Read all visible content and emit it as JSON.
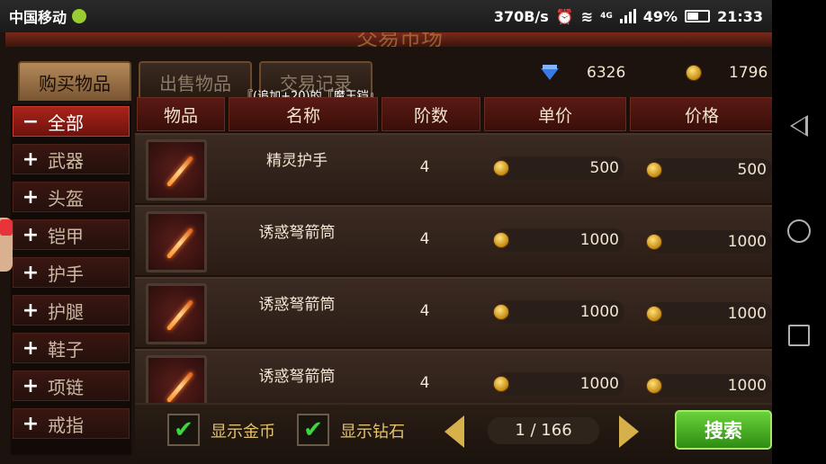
{
  "status_bar": {
    "carrier": "中国移动",
    "net_speed": "370B/s",
    "network_type": "4G",
    "battery": "49%",
    "time": "21:33"
  },
  "title_partial": "交易市场",
  "tabs": [
    {
      "label": "购买物品",
      "active": true
    },
    {
      "label": "出售物品",
      "active": false
    },
    {
      "label": "交易记录",
      "active": false
    }
  ],
  "currency": {
    "diamonds": "6326",
    "gold": "1796"
  },
  "tooltip": "『(追加+20)的『魔王铠』",
  "categories": [
    {
      "symbol": "−",
      "label": "全部",
      "active": true
    },
    {
      "symbol": "+",
      "label": "武器"
    },
    {
      "symbol": "+",
      "label": "头盔"
    },
    {
      "symbol": "+",
      "label": "铠甲"
    },
    {
      "symbol": "+",
      "label": "护手"
    },
    {
      "symbol": "+",
      "label": "护腿"
    },
    {
      "symbol": "+",
      "label": "鞋子"
    },
    {
      "symbol": "+",
      "label": "项链"
    },
    {
      "symbol": "+",
      "label": "戒指"
    }
  ],
  "columns": [
    "物品",
    "名称",
    "阶数",
    "单价",
    "价格"
  ],
  "rows": [
    {
      "name": "精灵护手",
      "tier": "4",
      "unit_price": "500",
      "price": "500"
    },
    {
      "name": "诱惑弩箭筒",
      "tier": "4",
      "unit_price": "1000",
      "price": "1000"
    },
    {
      "name": "诱惑弩箭筒",
      "tier": "4",
      "unit_price": "1000",
      "price": "1000"
    },
    {
      "name": "诱惑弩箭筒",
      "tier": "4",
      "unit_price": "1000",
      "price": "1000"
    }
  ],
  "filters": {
    "show_gold": "显示金币",
    "show_diamonds": "显示钻石"
  },
  "pagination": "1 / 166",
  "search_label": "搜索",
  "colors": {
    "accent_red": "#a8241c",
    "search_green": "#4caf28",
    "gold_text": "#e2c36a"
  }
}
